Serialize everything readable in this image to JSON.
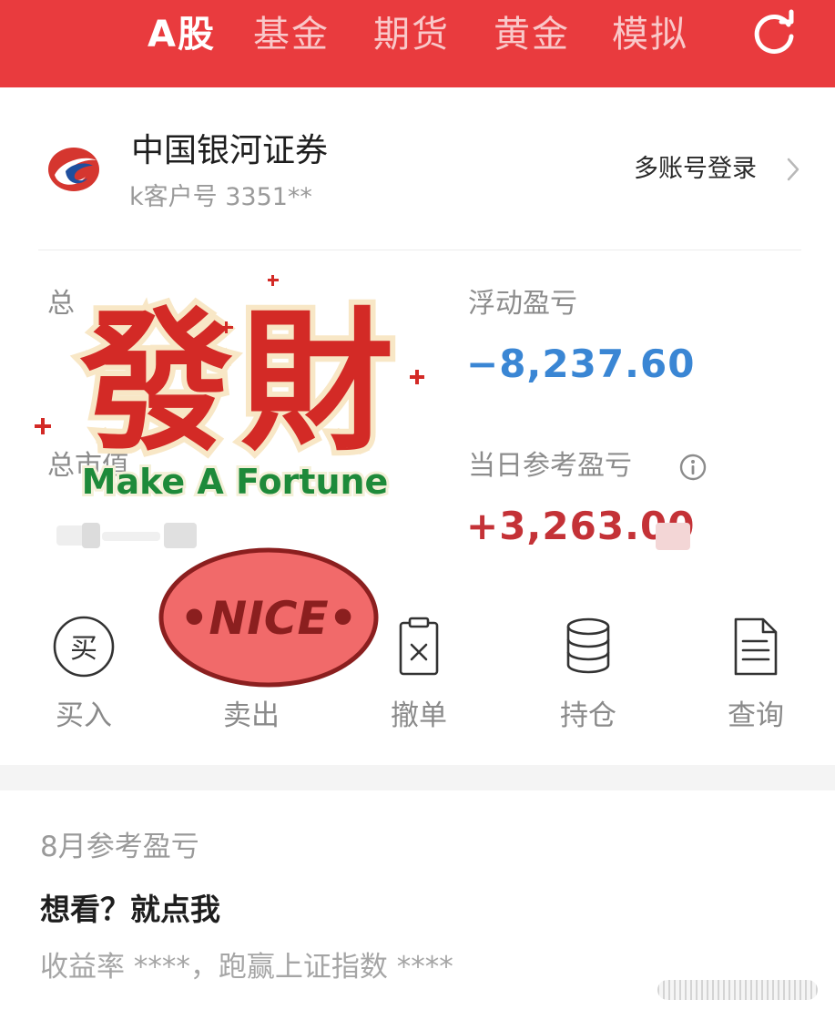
{
  "top_tabs": {
    "items": [
      {
        "label": "A股",
        "active": true
      },
      {
        "label": "基金",
        "active": false
      },
      {
        "label": "期货",
        "active": false
      },
      {
        "label": "黄金",
        "active": false
      },
      {
        "label": "模拟",
        "active": false
      }
    ],
    "refresh_icon": "refresh-icon",
    "background_color": "#e93b3e"
  },
  "account": {
    "broker_name": "中国银河证券",
    "customer_number": "k客户号 3351**",
    "multi_login": "多账号登录",
    "logo_icon": "galaxy-securities-logo"
  },
  "assets": {
    "total_assets_label": "总",
    "floating_pnl_label": "浮动盈亏",
    "floating_pnl_value": "−8,237.60",
    "market_value_label": "总市值",
    "daily_pnl_label": "当日参考盈亏",
    "daily_pnl_value": "+3,263.00",
    "info_icon": "info-icon",
    "colors": {
      "loss": "#3a86d4",
      "gain": "#c43237"
    }
  },
  "stickers": {
    "fortune_chars": "發財",
    "fortune_subtitle": "Make A Fortune",
    "nice_text": "•NICE•"
  },
  "actions": [
    {
      "label": "买入",
      "icon": "buy-icon",
      "icon_char": "买"
    },
    {
      "label": "卖出",
      "icon": "sell-icon"
    },
    {
      "label": "撤单",
      "icon": "cancel-order-icon"
    },
    {
      "label": "持仓",
      "icon": "holdings-icon"
    },
    {
      "label": "查询",
      "icon": "query-document-icon"
    }
  ],
  "monthly": {
    "title": "8月参考盈亏",
    "cta": "想看？就点我",
    "detail": "收益率 ****，跑赢上证指数 ****"
  }
}
